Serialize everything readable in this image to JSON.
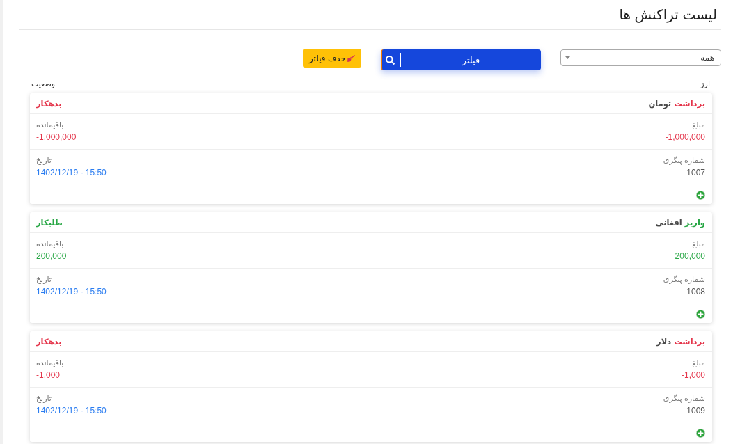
{
  "header": {
    "title": "لیست تراکنش ها"
  },
  "toolbar": {
    "status_select": {
      "value": "همه"
    },
    "filter_button": {
      "label": "فیلتر"
    },
    "clear_filter_button": {
      "label": "حذف فیلتر"
    }
  },
  "columns": [
    "ارز",
    "وضعیت"
  ],
  "transactions": [
    {
      "kind": "withdrawal",
      "type": "برداشت",
      "currency": "تومان",
      "status": {
        "kind": "debtor",
        "label": "بدهکار"
      },
      "amount": {
        "label": "مبلغ",
        "value": "-1,000,000"
      },
      "balance": {
        "label": "باقیمانده",
        "value": "-1,000,000"
      },
      "tracking": {
        "label": "شماره پیگری",
        "value": "1007"
      },
      "date": {
        "label": "تاریخ",
        "value": "1402/12/19 - 15:50"
      }
    },
    {
      "kind": "deposit",
      "type": "واریز",
      "currency": "افغانی",
      "status": {
        "kind": "creditor",
        "label": "طلبکار"
      },
      "amount": {
        "label": "مبلغ",
        "value": "200,000"
      },
      "balance": {
        "label": "باقیمانده",
        "value": "200,000"
      },
      "tracking": {
        "label": "شماره پیگری",
        "value": "1008"
      },
      "date": {
        "label": "تاریخ",
        "value": "1402/12/19 - 15:50"
      }
    },
    {
      "kind": "withdrawal",
      "type": "برداشت",
      "currency": "دلار",
      "status": {
        "kind": "debtor",
        "label": "بدهکار"
      },
      "amount": {
        "label": "مبلغ",
        "value": "-1,000"
      },
      "balance": {
        "label": "باقیمانده",
        "value": "-1,000"
      },
      "tracking": {
        "label": "شماره پیگری",
        "value": "1009"
      },
      "date": {
        "label": "تاریخ",
        "value": "1402/12/19 - 15:50"
      }
    }
  ]
}
